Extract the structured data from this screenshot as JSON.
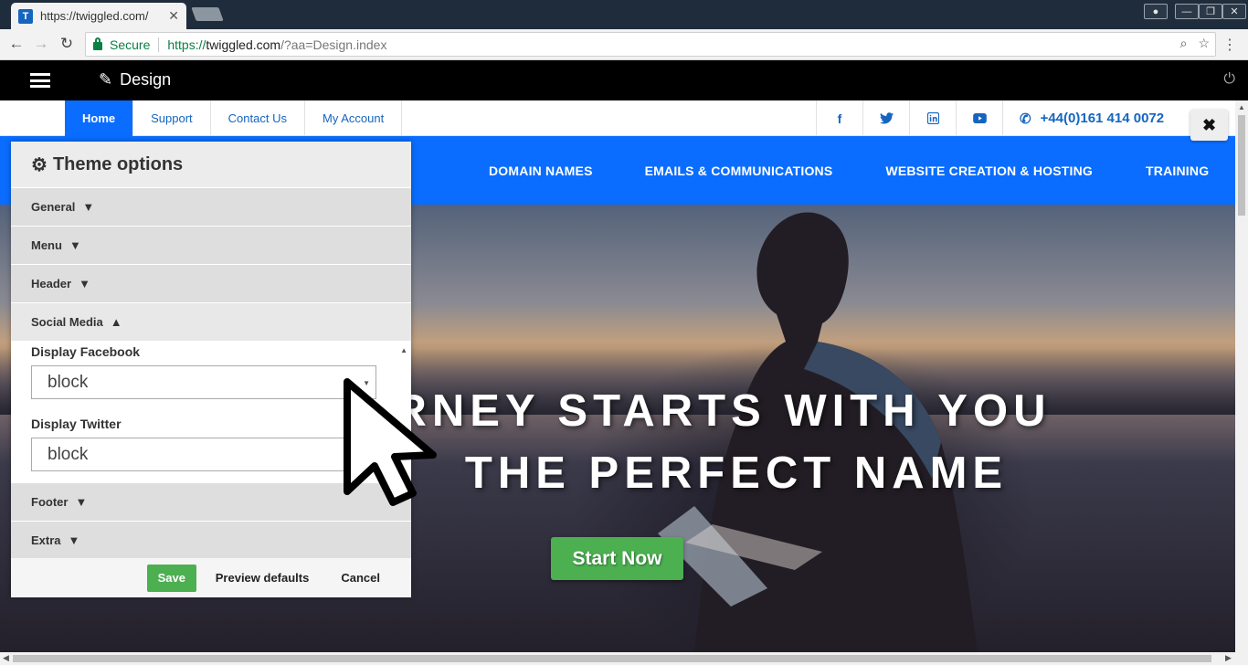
{
  "browser": {
    "tab_title": "https://twiggled.com/",
    "tab_favicon_letter": "T",
    "secure_label": "Secure",
    "url_scheme": "https://",
    "url_host": "twiggled.com",
    "url_path": "/?aa=Design.index"
  },
  "design_bar": {
    "title": "Design"
  },
  "site": {
    "top_nav": [
      "Home",
      "Support",
      "Contact Us",
      "My Account"
    ],
    "phone": "+44(0)161 414 0072",
    "main_nav": [
      "DOMAIN NAMES",
      "EMAILS & COMMUNICATIONS",
      "WEBSITE CREATION & HOSTING",
      "TRAINING"
    ],
    "headline_line1": "RNEY STARTS WITH YOU",
    "headline_line2": "THE PERFECT NAME",
    "cta": "Start Now"
  },
  "panel": {
    "title": "Theme options",
    "sections": {
      "general": "General",
      "menu": "Menu",
      "header": "Header",
      "social_media": "Social Media",
      "footer": "Footer",
      "extra": "Extra"
    },
    "fields": {
      "facebook_label": "Display Facebook",
      "facebook_value": "block",
      "twitter_label": "Display Twitter",
      "twitter_value": "block"
    },
    "buttons": {
      "save": "Save",
      "preview": "Preview defaults",
      "cancel": "Cancel"
    }
  },
  "colors": {
    "accent_blue": "#0a6dff",
    "cta_green": "#4caf50"
  }
}
